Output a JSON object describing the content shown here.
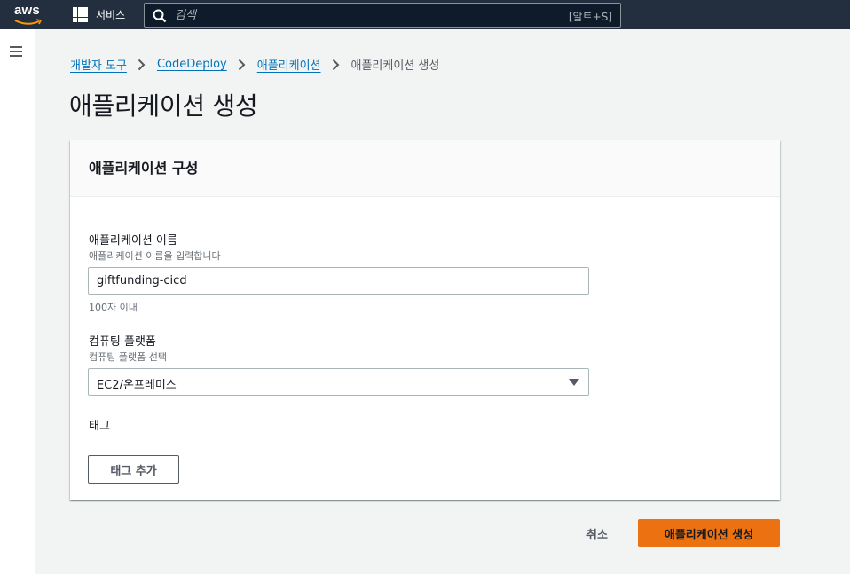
{
  "topnav": {
    "logo_text": "aws",
    "services_label": "서비스",
    "search_placeholder": "검색",
    "search_shortcut": "[알트+S]"
  },
  "breadcrumb": {
    "items": [
      "개발자 도구",
      "CodeDeploy",
      "애플리케이션"
    ],
    "current": "애플리케이션 생성"
  },
  "page": {
    "title": "애플리케이션 생성"
  },
  "panel": {
    "title": "애플리케이션 구성",
    "app_name": {
      "label": "애플리케이션 이름",
      "description": "애플리케이션 이름을 입력합니다",
      "value": "giftfunding-cicd",
      "constraint": "100자 이내"
    },
    "platform": {
      "label": "컴퓨팅 플랫폼",
      "description": "컴퓨팅 플랫폼 선택",
      "selected": "EC2/온프레미스"
    },
    "tags": {
      "label": "태그",
      "add_button": "태그 추가"
    }
  },
  "actions": {
    "cancel": "취소",
    "submit": "애플리케이션 생성"
  },
  "colors": {
    "nav_bg": "#232f3e",
    "link": "#0073bb",
    "primary": "#ec7211"
  }
}
